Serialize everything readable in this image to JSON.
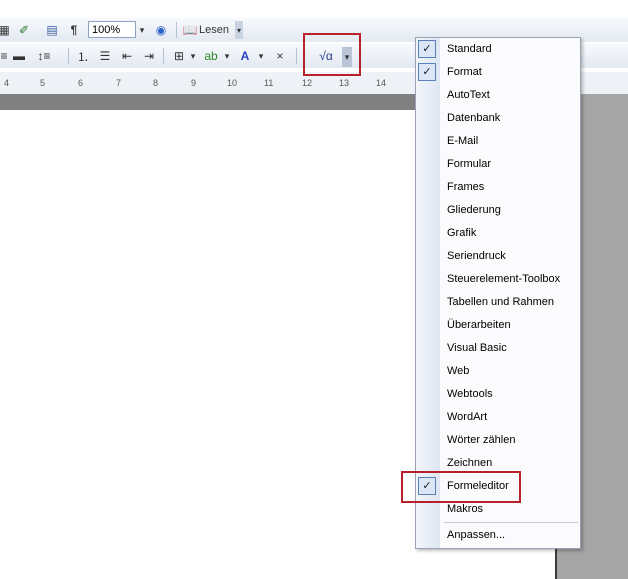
{
  "toolbar": {
    "zoom_value": "100%",
    "reading_mode_label": "Lesen"
  },
  "ruler": {
    "numbers": [
      "4",
      "5",
      "6",
      "7",
      "8",
      "9",
      "10",
      "11",
      "12",
      "13",
      "14"
    ]
  },
  "toolbars_menu": {
    "items": [
      {
        "label": "Standard",
        "checked": true
      },
      {
        "label": "Format",
        "checked": true
      },
      {
        "label": "AutoText",
        "checked": false
      },
      {
        "label": "Datenbank",
        "checked": false
      },
      {
        "label": "E-Mail",
        "checked": false
      },
      {
        "label": "Formular",
        "checked": false
      },
      {
        "label": "Frames",
        "checked": false
      },
      {
        "label": "Gliederung",
        "checked": false
      },
      {
        "label": "Grafik",
        "checked": false
      },
      {
        "label": "Seriendruck",
        "checked": false
      },
      {
        "label": "Steuerelement-Toolbox",
        "checked": false
      },
      {
        "label": "Tabellen und Rahmen",
        "checked": false
      },
      {
        "label": "Überarbeiten",
        "checked": false
      },
      {
        "label": "Visual Basic",
        "checked": false
      },
      {
        "label": "Web",
        "checked": false
      },
      {
        "label": "Webtools",
        "checked": false
      },
      {
        "label": "WordArt",
        "checked": false
      },
      {
        "label": "Wörter zählen",
        "checked": false
      },
      {
        "label": "Zeichnen",
        "checked": false
      },
      {
        "label": "Formeleditor",
        "checked": true
      },
      {
        "label": "Makros",
        "checked": false
      }
    ],
    "customize_label": "Anpassen...",
    "check_mark": "✓"
  },
  "colors": {
    "highlight_border": "#b8212c",
    "check_box_fill": "#dbe6f6",
    "check_box_border": "#5b7fb8"
  }
}
